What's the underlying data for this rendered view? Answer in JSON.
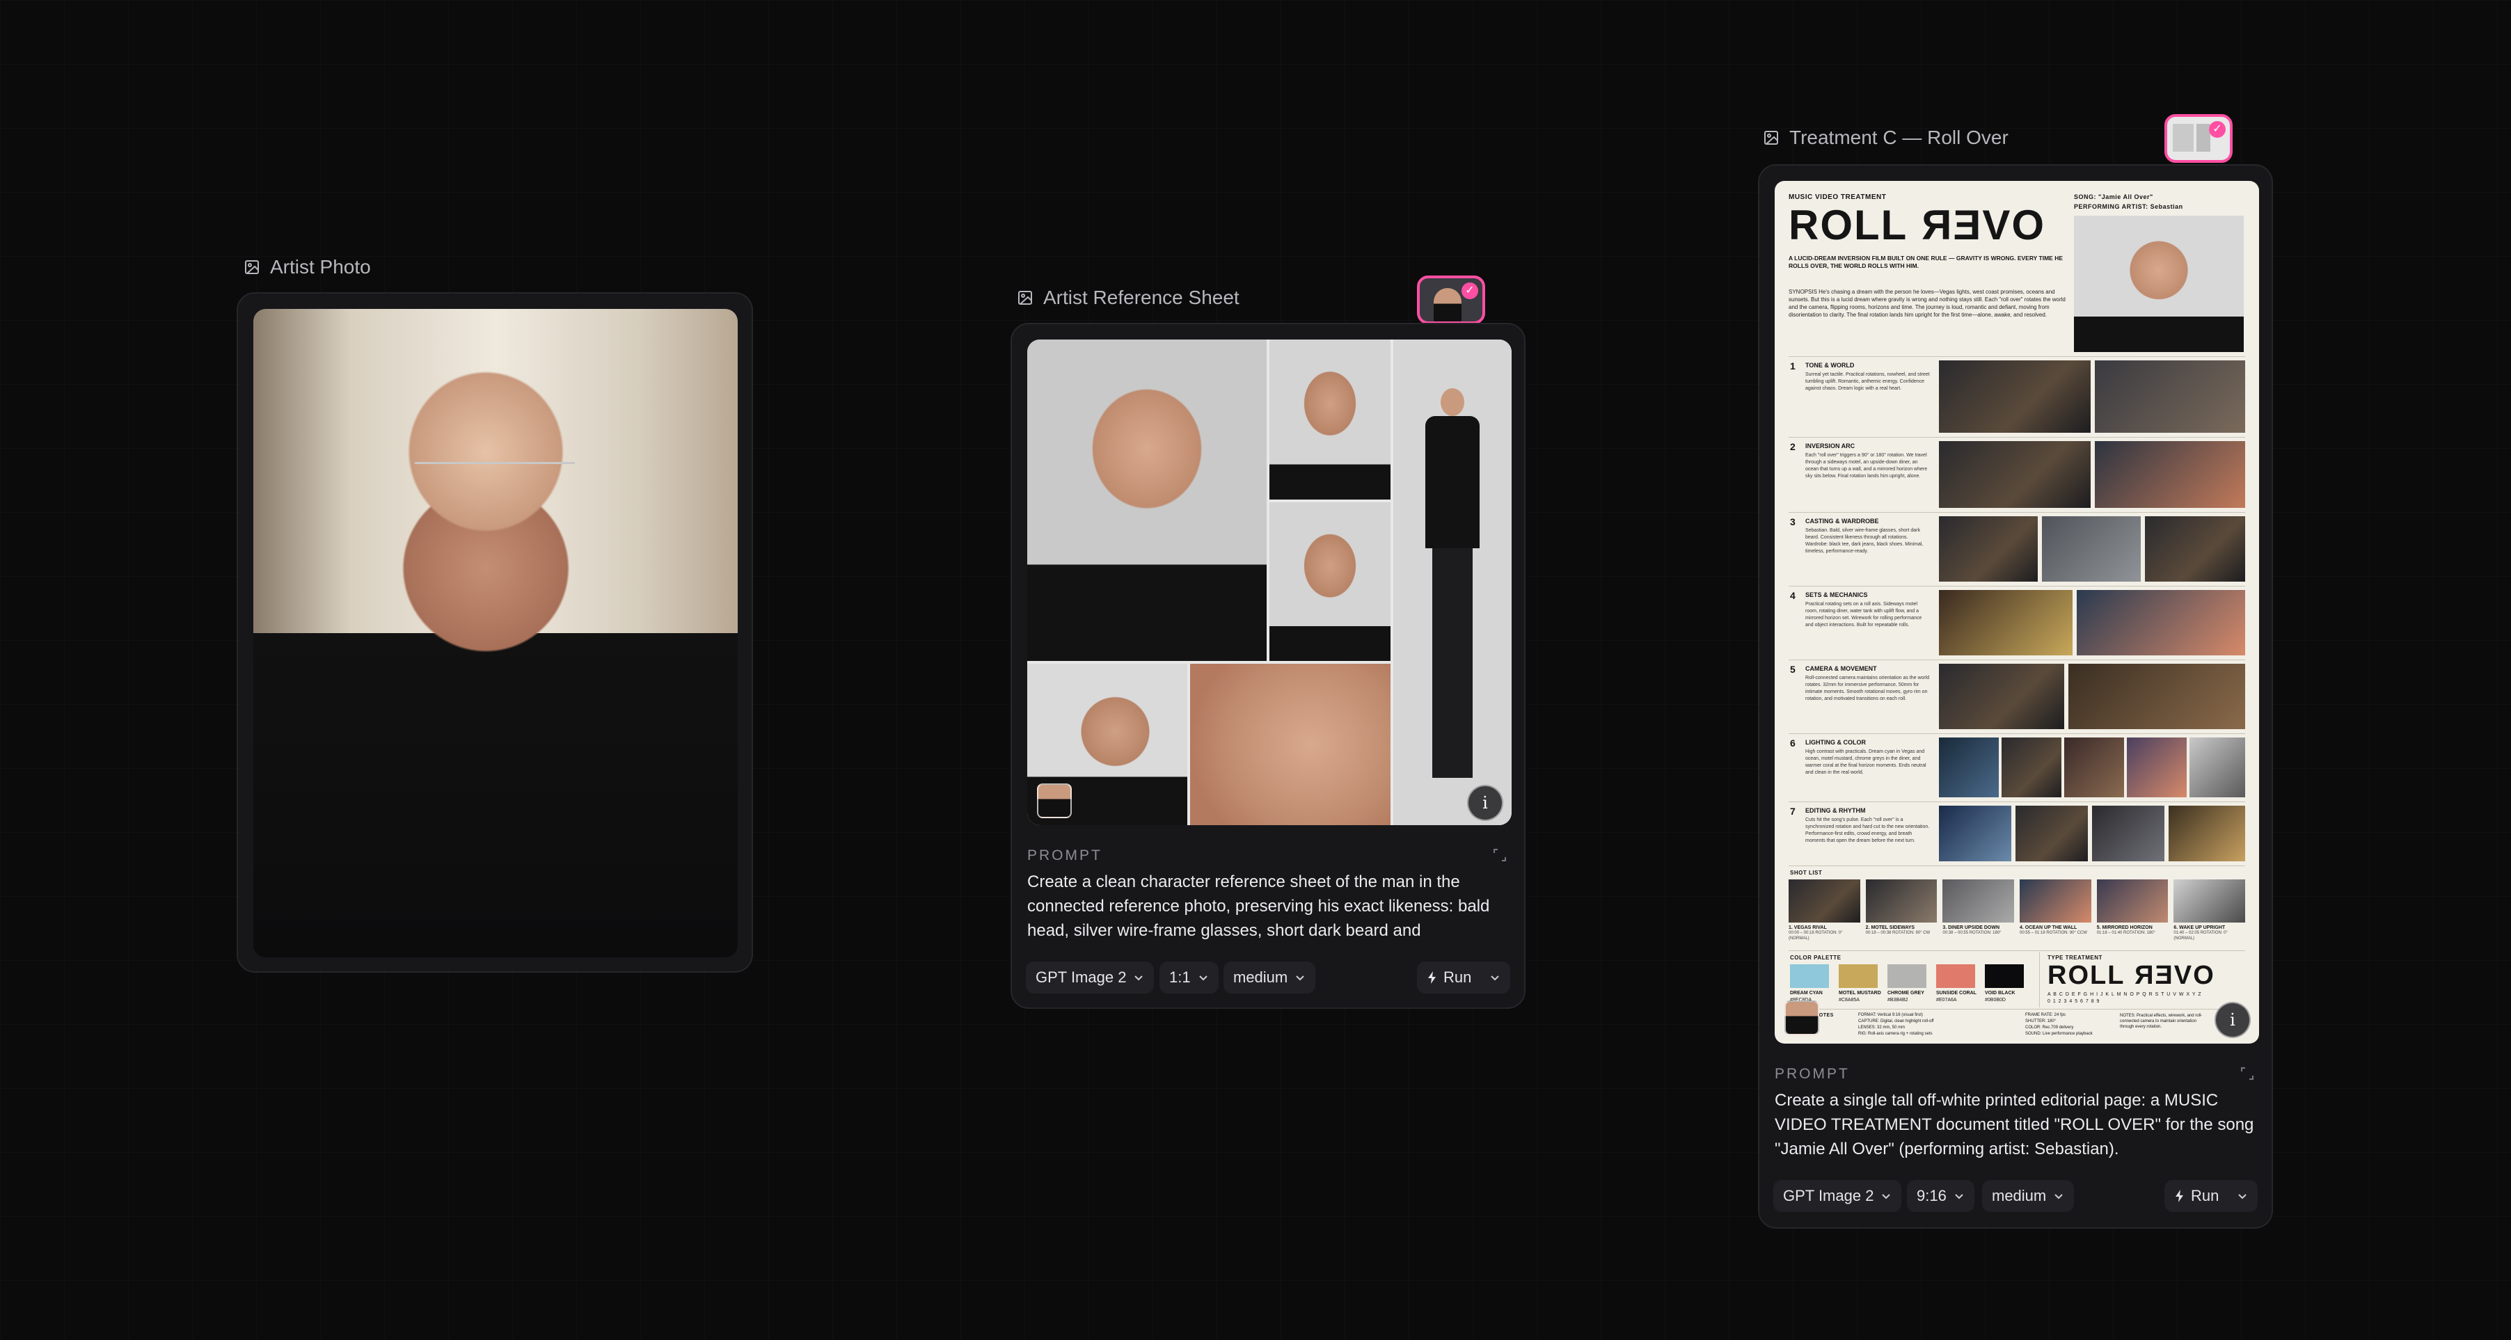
{
  "nodes": {
    "artist_photo": {
      "title": "Artist Photo"
    },
    "reference_sheet": {
      "title": "Artist Reference Sheet",
      "prompt_label": "PROMPT",
      "prompt_text": "Create a clean character reference sheet of the man in the connected reference photo, preserving his exact likeness: bald head, silver wire-frame glasses, short dark beard and",
      "model": "GPT Image 2",
      "ratio": "1:1",
      "quality": "medium",
      "run_label": "Run"
    },
    "treatment": {
      "title": "Treatment C — Roll Over",
      "prompt_label": "PROMPT",
      "prompt_text": "Create a single tall off-white printed editorial page: a MUSIC VIDEO TREATMENT document titled \"ROLL OVER\" for the song \"Jamie All Over\" (performing artist: Sebastian).",
      "model": "GPT Image 2",
      "ratio": "9:16",
      "quality": "medium",
      "run_label": "Run"
    }
  },
  "document": {
    "kicker": "MUSIC VIDEO TREATMENT",
    "title_a": "ROLL",
    "title_b": "OVER",
    "song": "SONG:  \"Jamie All Over\"",
    "artist": "PERFORMING ARTIST:  Sebastian",
    "logline": "A LUCID-DREAM INVERSION FILM BUILT ON ONE RULE — GRAVITY IS WRONG. EVERY TIME HE ROLLS OVER, THE WORLD ROLLS WITH HIM.",
    "synopsis": "SYNOPSIS  He's chasing a dream with the person he loves—Vegas lights, west coast promises, oceans and sunsets. But this is a lucid dream where gravity is wrong and nothing stays still. Each \"roll over\" rotates the world and the camera, flipping rooms, horizons and time. The journey is loud, romantic and defiant, moving from disorientation to clarity. The final rotation lands him upright for the first time—alone, awake, and resolved.",
    "sections": [
      {
        "num": "1",
        "title": "TONE & WORLD",
        "body": "Surreal yet tactile. Practical rotations, nowheel, and street tumbling uplift. Romantic, anthemic energy. Confidence against chaos. Dream logic with a real heart."
      },
      {
        "num": "2",
        "title": "INVERSION ARC",
        "body": "Each \"roll over\" triggers a 90° or 180° rotation. We travel through a sideways motel, an upside-down diner, an ocean that turns up a wall, and a mirrored horizon where sky sits below. Final rotation lands him upright, alone."
      },
      {
        "num": "3",
        "title": "CASTING & WARDROBE",
        "body": "Sebastian. Bald, silver wire-frame glasses, short dark beard. Consistent likeness through all rotations. Wardrobe: black tee, dark jeans, black shoes. Minimal, timeless, performance-ready."
      },
      {
        "num": "4",
        "title": "SETS & MECHANICS",
        "body": "Practical rotating sets on a roll axis. Sideways motel room, rotating diner, water tank with uplift flow, and a mirrored horizon set. Wirework for rolling performance and object interactions. Built for repeatable rolls."
      },
      {
        "num": "5",
        "title": "CAMERA & MOVEMENT",
        "body": "Roll-connected camera maintains orientation as the world rotates. 32mm for immersive performance, 50mm for intimate moments. Smooth rotational moves, gyro rim on rotation, and motivated transitions on each roll."
      },
      {
        "num": "6",
        "title": "LIGHTING & COLOR",
        "body": "High contrast with practicals. Dream cyan in Vegas and ocean, motel mustard, chrome greys in the diner, and warmer coral at the final horizon moments. Ends neutral and clean in the real world."
      },
      {
        "num": "7",
        "title": "EDITING & RHYTHM",
        "body": "Cuts hit the song's pulse. Each \"roll over\" is a synchronized rotation and hard cut to the new orientation. Performance-first edits, crowd energy, and breath moments that open the dream before the next turn."
      }
    ],
    "shot_list_label": "SHOT LIST",
    "shots": [
      {
        "label": "1. VEGAS RIVAL",
        "meta": "00:00 – 00:18  ROTATION: 0° (NORMAL)"
      },
      {
        "label": "2. MOTEL SIDEWAYS",
        "meta": "00:18 – 00:38  ROTATION: 90° CW"
      },
      {
        "label": "3. DINER UPSIDE DOWN",
        "meta": "00:38 – 00:55  ROTATION: 180°"
      },
      {
        "label": "4. OCEAN UP THE WALL",
        "meta": "00:55 – 01:18  ROTATION: 90° CCW"
      },
      {
        "label": "5. MIRRORED HORIZON",
        "meta": "01:18 – 01:40  ROTATION: 180°"
      },
      {
        "label": "6. WAKE UP UPRIGHT",
        "meta": "01:40 – 02:05  ROTATION: 0° (NORMAL)"
      }
    ],
    "palette_label": "COLOR PALETTE",
    "palette": [
      {
        "name": "DREAM CYAN",
        "hex": "#8EC8DA",
        "color": "#8ec8da"
      },
      {
        "name": "MOTEL MUSTARD",
        "hex": "#C8A85A",
        "color": "#c8a85a"
      },
      {
        "name": "CHROME GREY",
        "hex": "#B3B4B2",
        "color": "#b3b4b2"
      },
      {
        "name": "SUNSIDE CORAL",
        "hex": "#E07A6A",
        "color": "#e07a6a"
      },
      {
        "name": "VOID BLACK",
        "hex": "#0B0B0D",
        "color": "#0b0b0d"
      }
    ],
    "type_label": "TYPE TREATMENT",
    "type_alphabet": "A B C D E F G H I J K L M N O P Q R S T U V W X Y Z",
    "type_digits": "0 1 2 3 4 5 6 7 8 9",
    "tech_label": "CAL NOTES",
    "tech_lines": [
      "FORMAT:  Vertical 9:16 (visual first)",
      "CAPTURE:  Digital, clean highlight roll-off",
      "LENSES:  32 mm, 50 mm",
      "RIG:  Roll-axis camera rig + rotating sets"
    ],
    "tech_lines_b": [
      "FRAME RATE:  24 fps",
      "SHUTTER:  180°",
      "COLOR:  Rec.709 delivery",
      "SOUND:  Live performance playback"
    ],
    "notes": "NOTES:  Practical effects, wirework, and roll-connected camera to maintain orientation through every rotation."
  },
  "colors": {
    "accent_pink": "#ff4fa3",
    "canvas": "#0b0b0c",
    "card": "#17171a"
  },
  "icons": [
    "image-icon",
    "expand-icon",
    "chevron-down-icon",
    "bolt-icon",
    "info-icon",
    "check-icon"
  ]
}
